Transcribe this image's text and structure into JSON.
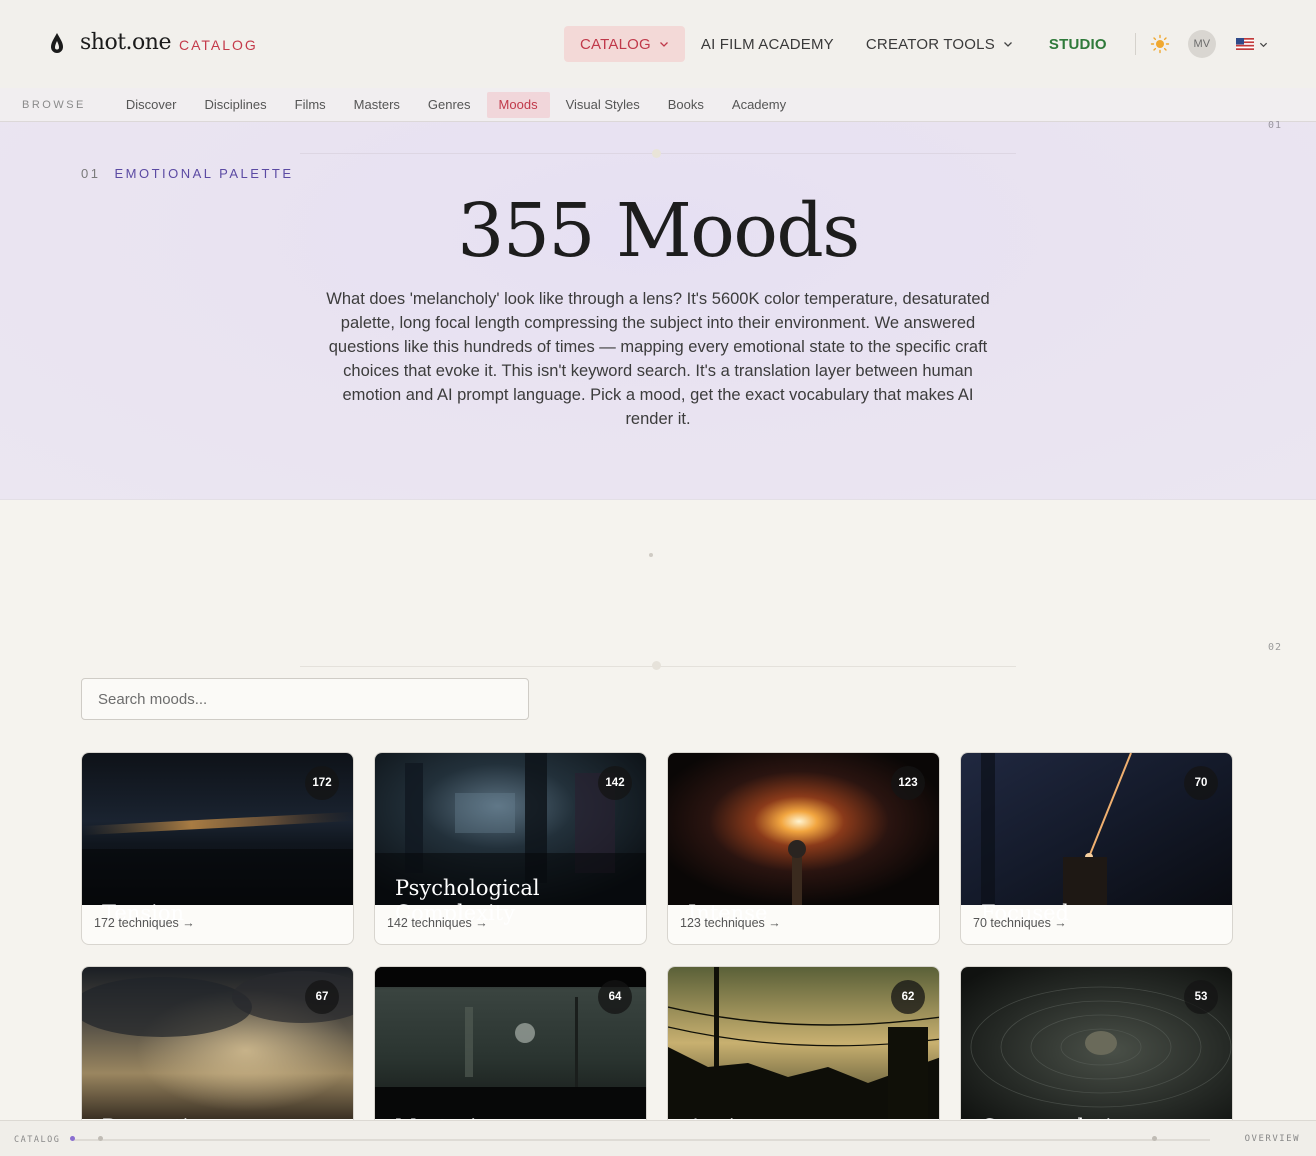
{
  "header": {
    "brand": "shot.one",
    "section": "CATALOG",
    "nav": [
      {
        "label": "CATALOG",
        "active": true,
        "dropdown": true
      },
      {
        "label": "AI FILM ACADEMY",
        "active": false,
        "dropdown": false
      },
      {
        "label": "CREATOR TOOLS",
        "active": false,
        "dropdown": true
      },
      {
        "label": "STUDIO",
        "active": false,
        "dropdown": false
      }
    ],
    "avatar_initials": "MV",
    "icons": {
      "logo": "drop-logo-icon",
      "theme": "sun-icon",
      "locale": "us-flag-icon"
    }
  },
  "subnav": {
    "label": "BROWSE",
    "items": [
      "Discover",
      "Disciplines",
      "Films",
      "Masters",
      "Genres",
      "Moods",
      "Visual Styles",
      "Books",
      "Academy"
    ],
    "active": "Moods"
  },
  "hero": {
    "section_number": "01",
    "eyebrow_number": "01",
    "eyebrow": "EMOTIONAL PALETTE",
    "title": "355 Moods",
    "body": "What does 'melancholy' look like through a lens? It's 5600K color temperature, desaturated palette, long focal length compressing the subject into their environment. We answered questions like this hundreds of times — mapping every emotional state to the specific craft choices that evoke it. This isn't keyword search. It's a translation layer between human emotion and AI prompt language. Pick a mood, get the exact vocabulary that makes AI render it."
  },
  "moods_section": {
    "section_number": "02",
    "search_placeholder": "Search moods...",
    "cards": [
      {
        "title": "Tension",
        "count": "172",
        "footer": "172 techniques →"
      },
      {
        "title": "Psychological Complexity",
        "count": "142",
        "footer": "142 techniques →"
      },
      {
        "title": "Intense",
        "count": "123",
        "footer": "123 techniques →"
      },
      {
        "title": "Focused",
        "count": "70",
        "footer": "70 techniques →"
      },
      {
        "title": "Dramatic",
        "count": "67",
        "footer": ""
      },
      {
        "title": "Mysterious",
        "count": "64",
        "footer": ""
      },
      {
        "title": "Anxiety",
        "count": "62",
        "footer": ""
      },
      {
        "title": "Contemplative",
        "count": "53",
        "footer": ""
      }
    ]
  },
  "timeline": {
    "left_label": "CATALOG",
    "right_label": "OVERVIEW"
  },
  "colors": {
    "accent": "#c0394a",
    "studio": "#2f7a3a",
    "eyebrow": "#5b4aa3",
    "hero_bg": "#e9e3f1",
    "page_bg": "#f5f3ee"
  }
}
